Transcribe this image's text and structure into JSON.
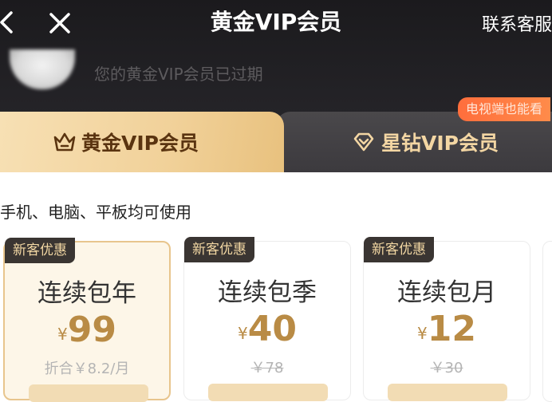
{
  "topbar": {
    "title": "黄金VIP会员",
    "contact": "联系客服"
  },
  "account": {
    "status": "您的黄金VIP会员已过期"
  },
  "tabs": [
    {
      "label": "黄金VIP会员",
      "icon": "crown-icon",
      "selected": true
    },
    {
      "label": "星钻VIP会员",
      "icon": "diamond-icon",
      "selected": false
    }
  ],
  "tv_badge": "电视端也能看",
  "devices_text": "手机、电脑、平板均可使用",
  "plans": [
    {
      "badge": "新客优惠",
      "name": "连续包年",
      "currency": "¥",
      "price": "99",
      "sub": "折合￥8.2/月",
      "selected": true
    },
    {
      "badge": "新客优惠",
      "name": "连续包季",
      "currency": "¥",
      "price": "40",
      "sub": "￥78",
      "selected": false
    },
    {
      "badge": "新客优惠",
      "name": "连续包月",
      "currency": "¥",
      "price": "12",
      "sub": "￥30",
      "selected": false
    }
  ],
  "colors": {
    "header_bg": "#1f1e21",
    "gold_tab": "#f1d199",
    "price_gold": "#b98b45",
    "badge_bg": "#3a3532",
    "tv_badge": "#ff7a40"
  }
}
